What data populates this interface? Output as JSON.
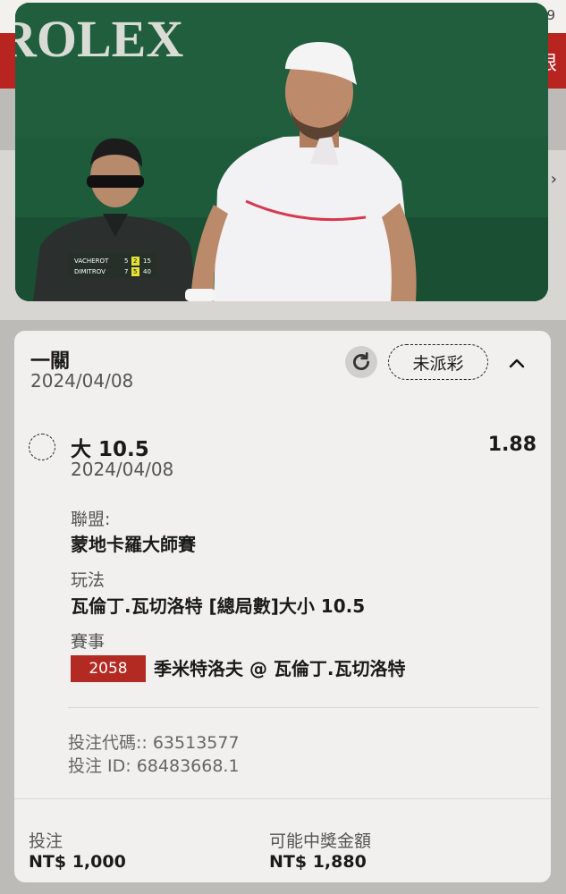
{
  "background": {
    "top_number": "9",
    "red_bar_char": "限",
    "side_arrow": "›"
  },
  "video": {
    "banner_text": "ROLEX",
    "scoreboard": {
      "rows": [
        {
          "player": "VACHEROT",
          "sets": "5",
          "games": "2",
          "points": "15"
        },
        {
          "player": "DIMITROV",
          "sets": "7",
          "games": "5",
          "points": "40"
        }
      ]
    }
  },
  "bet": {
    "type_title": "一關",
    "placed_date": "2024/04/08",
    "status": "未派彩",
    "selection": {
      "name": "大 10.5",
      "odds": "1.88",
      "date": "2024/04/08"
    },
    "league_label": "聯盟:",
    "league": "蒙地卡羅大師賽",
    "market_label": "玩法",
    "market": "瓦倫丁.瓦切洛特 [總局數]大小 10.5",
    "event_label": "賽事",
    "event_id": "2058",
    "event_name": "季米特洛夫 @ 瓦倫丁.瓦切洛特",
    "bet_code": "投注代碼:: 63513577",
    "bet_id": "投注 ID: 68483668.1",
    "stake_label": "投注",
    "stake": "NT$ 1,000",
    "payout_label": "可能中獎金額",
    "payout": "NT$ 1,880"
  },
  "colors": {
    "accent_red": "#b22a22",
    "card_bg": "#f1f0ee"
  }
}
